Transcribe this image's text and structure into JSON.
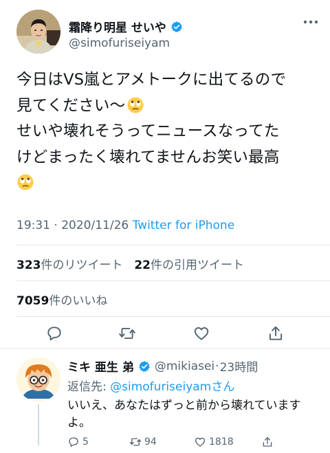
{
  "tweet": {
    "author_name": "霜降り明星 せいや",
    "author_handle": "@simofuriseiyam",
    "text_lines": [
      "今日はVS嵐とアメトークに出てるので",
      "見てください〜",
      "せいや壊れそうってニュースなってた",
      "けどまったく壊れてませんお笑い最高",
      ""
    ],
    "emoji": "face-with-rolling-eyes",
    "time": "19:31",
    "separator": "·",
    "date": "2020/11/26",
    "source": "Twitter for iPhone",
    "retweets_count": "323",
    "retweets_label": "件のリツイート",
    "quotes_count": "22",
    "quotes_label": "件の引用ツイート",
    "likes_count": "7059",
    "likes_label": "件のいいね"
  },
  "reply": {
    "author_name": "ミキ 亜生 弟",
    "author_handle": "@mikiasei",
    "separator": "·",
    "time_ago": "23時間",
    "reply_to_prefix": "返信先: ",
    "reply_to_handle": "@simofuriseiyam",
    "reply_to_suffix": "さん",
    "text": "いいえ、あなたはずっと前から壊れていますよ。",
    "reply_count": "5",
    "retweet_count": "94",
    "like_count": "1818"
  },
  "colors": {
    "accent": "#1d9bf0",
    "text_primary": "#0f1419",
    "text_secondary": "#536471",
    "divider": "#e1e8ed"
  }
}
